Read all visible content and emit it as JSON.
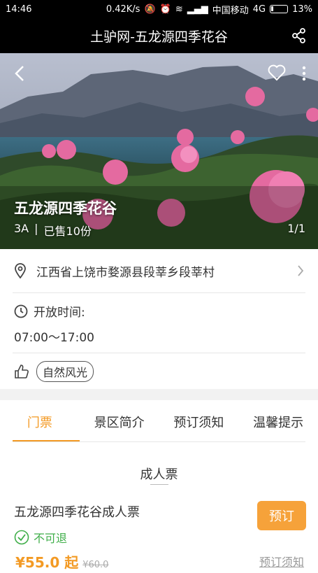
{
  "status": {
    "time": "14:46",
    "net_speed": "0.42K/s",
    "carrier": "中国移动",
    "network": "4G",
    "battery": "13%"
  },
  "header": {
    "title": "土驴网-五龙源四季花谷"
  },
  "hero": {
    "name": "五龙源四季花谷",
    "level": "3A",
    "divider": "|",
    "sold": "已售10份",
    "counter": "1/1"
  },
  "info": {
    "address": "江西省上饶市婺源县段莘乡段莘村",
    "hours_label": "开放时间:",
    "hours_value": "07:00～17:00",
    "tag": "自然风光"
  },
  "tabs": [
    {
      "label": "门票"
    },
    {
      "label": "景区简介"
    },
    {
      "label": "预订须知"
    },
    {
      "label": "温馨提示"
    }
  ],
  "ticket_section": {
    "title": "成人票",
    "ticket_name": "五龙源四季花谷成人票",
    "book_label": "预订",
    "refund_policy": "不可退",
    "price": "¥55.0 起",
    "original_price": "¥60.0",
    "notice_link": "预订须知"
  },
  "colors": {
    "accent": "#f39a24",
    "book_button": "#f6a23a",
    "no_refund": "#3fae49"
  },
  "icons": [
    "share-icon",
    "back-icon",
    "heart-icon",
    "more-icon",
    "location-icon",
    "chevron-right-icon",
    "clock-icon",
    "thumb-up-icon",
    "check-circle-icon"
  ]
}
